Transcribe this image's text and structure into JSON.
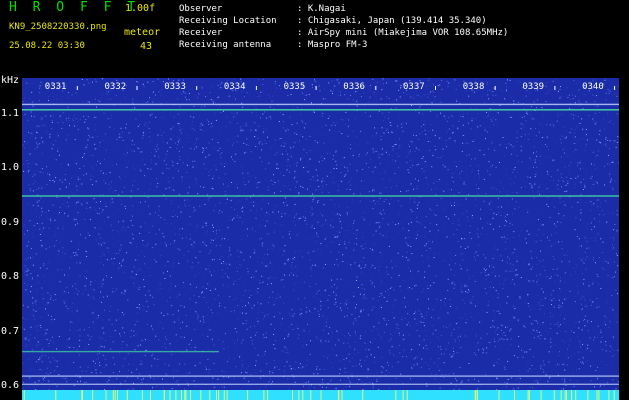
{
  "header": {
    "app_title": "H R O F F T",
    "version": "1.00f",
    "filename": "KN9_2508220330.png",
    "meteor_label": "meteor",
    "timestamp": "25.08.22 03:30",
    "meteor_count": "43",
    "observer_label": "Observer",
    "observer_value": ": K.Nagai",
    "location_label": "Receiving Location",
    "location_value": ": Chigasaki, Japan (139.414 35.340)",
    "receiver_label": "Receiver",
    "receiver_value": ": AirSpy mini (Miakejima VOR 108.65MHz)",
    "antenna_label": "Receiving antenna",
    "antenna_value": ": Maspro FM-3"
  },
  "spectrogram": {
    "y_unit": "kHz",
    "y_ticks": [
      {
        "label": "1.1",
        "value": 1.1
      },
      {
        "label": "1.0",
        "value": 1.0
      },
      {
        "label": "0.9",
        "value": 0.9
      },
      {
        "label": "0.8",
        "value": 0.8
      },
      {
        "label": "0.7",
        "value": 0.7
      },
      {
        "label": "0.6",
        "value": 0.6
      }
    ],
    "y_range": [
      0.575,
      1.165
    ],
    "time_ticks": [
      "0331",
      "0332",
      "0333",
      "0334",
      "0335",
      "0336",
      "0337",
      "0338",
      "0339",
      "0340"
    ],
    "bg_color": "#1a2ca8",
    "line_colors": {
      "green": "#40d8a0",
      "white": "#c8d8ff",
      "cyan": "#30e0ff"
    },
    "lines": [
      {
        "freq": 1.118,
        "color": "white",
        "strength": 0.6
      },
      {
        "freq": 1.108,
        "color": "green",
        "strength": 1.0
      },
      {
        "freq": 0.95,
        "color": "green",
        "strength": 0.85
      },
      {
        "freq": 0.665,
        "color": "green",
        "strength": 0.45,
        "end_fraction": 0.33
      },
      {
        "freq": 0.62,
        "color": "white",
        "strength": 0.5
      },
      {
        "freq": 0.605,
        "color": "white",
        "strength": 0.4
      }
    ]
  }
}
